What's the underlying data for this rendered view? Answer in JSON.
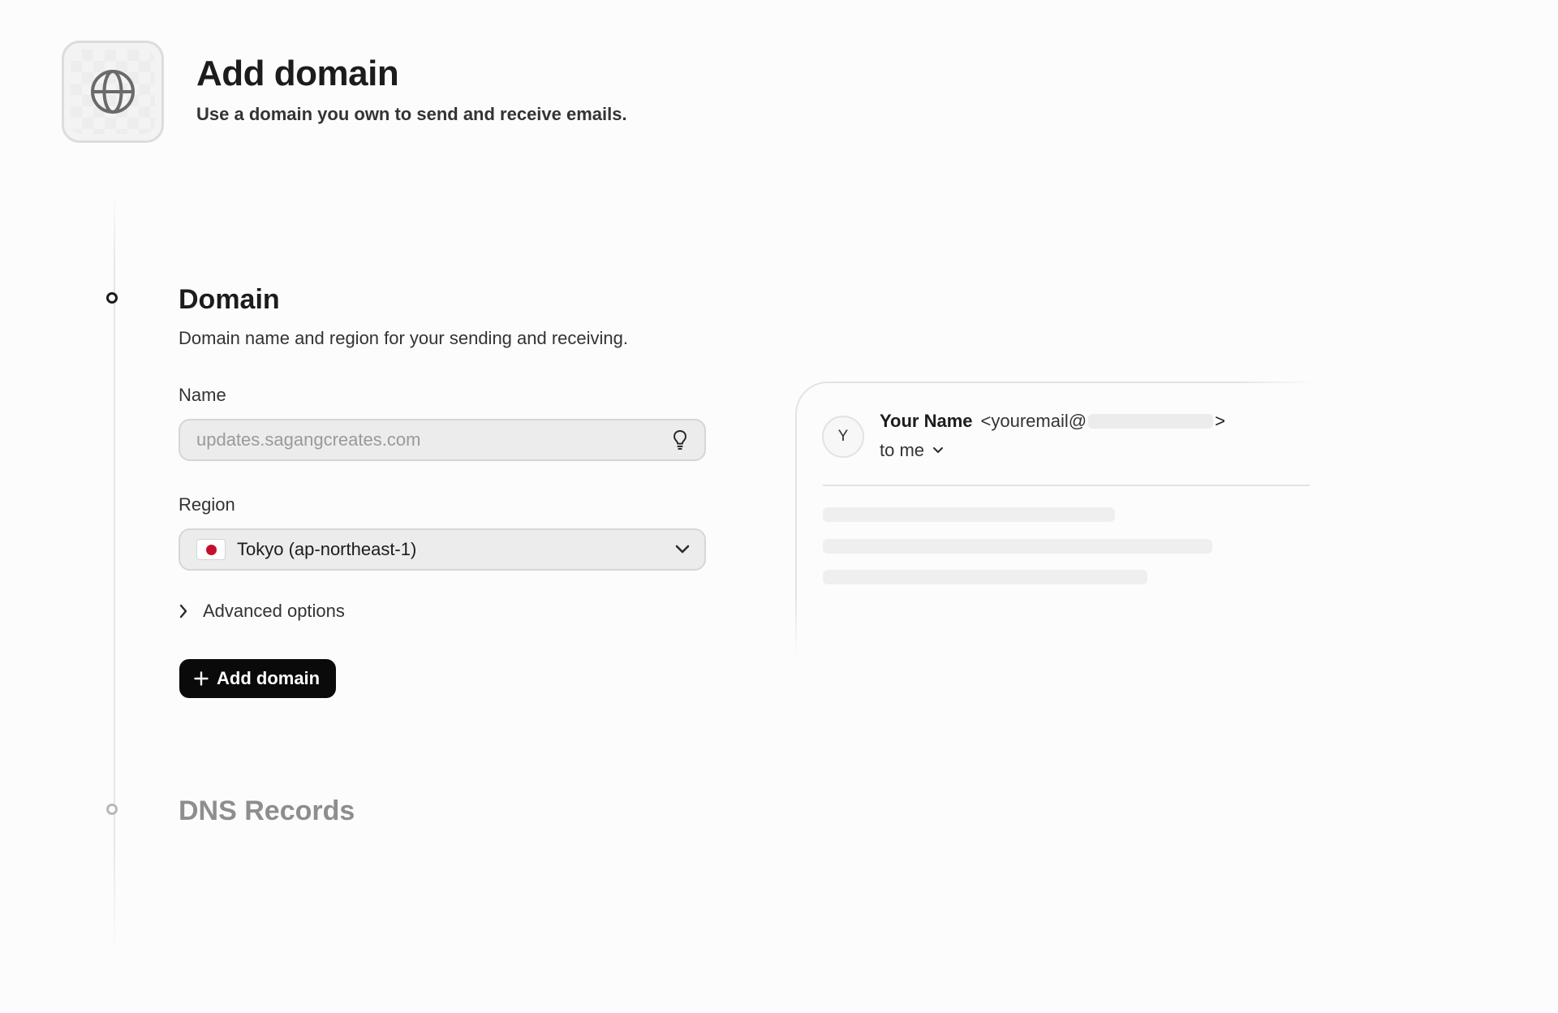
{
  "header": {
    "icon": "globe-icon",
    "title": "Add domain",
    "subtitle": "Use a domain you own to send and receive emails."
  },
  "steps": [
    {
      "title": "Domain",
      "state": "active"
    },
    {
      "title": "DNS Records",
      "state": "inactive"
    }
  ],
  "domain_section": {
    "title": "Domain",
    "description": "Domain name and region for your sending and receiving.",
    "name_field": {
      "label": "Name",
      "placeholder": "updates.sagangcreates.com",
      "value": "",
      "icon": "lightbulb-icon"
    },
    "region_field": {
      "label": "Region",
      "selected": "Tokyo (ap-northeast-1)",
      "flag_icon": "japan-flag-icon",
      "icon": "chevron-down-icon"
    },
    "advanced_label": "Advanced options",
    "add_button_label": "Add domain"
  },
  "dns_section": {
    "title": "DNS Records"
  },
  "preview": {
    "avatar_initial": "Y",
    "sender_name": "Your Name",
    "sender_email_prefix": "<youremail@",
    "sender_email_suffix": ">",
    "recipient": "to me"
  },
  "colors": {
    "primary_button": "#0a0a0a",
    "input_background": "#ececec",
    "muted_title": "#8e8e8e",
    "flag_red": "#c4102e"
  }
}
